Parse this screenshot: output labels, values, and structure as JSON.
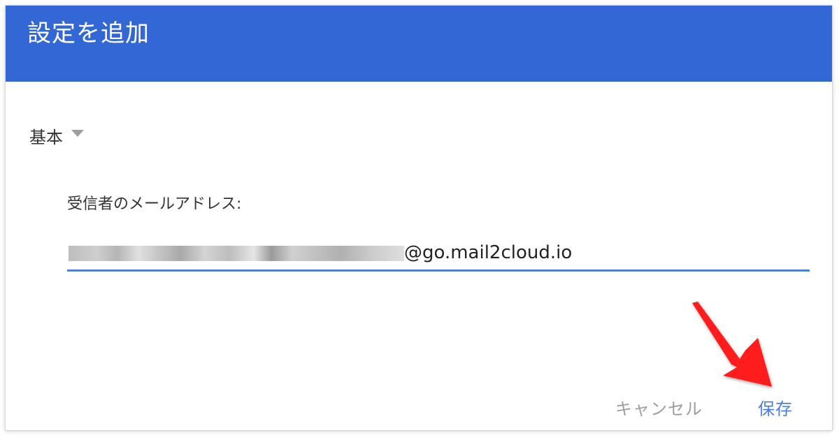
{
  "dialog": {
    "title": "設定を追加",
    "header_color": "#3367d6"
  },
  "section": {
    "label": "基本",
    "toggle_icon": "caret-down-icon"
  },
  "recipient_email": {
    "label": "受信者のメールアドレス:",
    "value_visible": "@go.mail2cloud.io"
  },
  "actions": {
    "cancel_label": "キャンセル",
    "save_label": "保存"
  },
  "annotation": {
    "icon": "red-arrow-icon",
    "color": "#ff1a1a"
  }
}
